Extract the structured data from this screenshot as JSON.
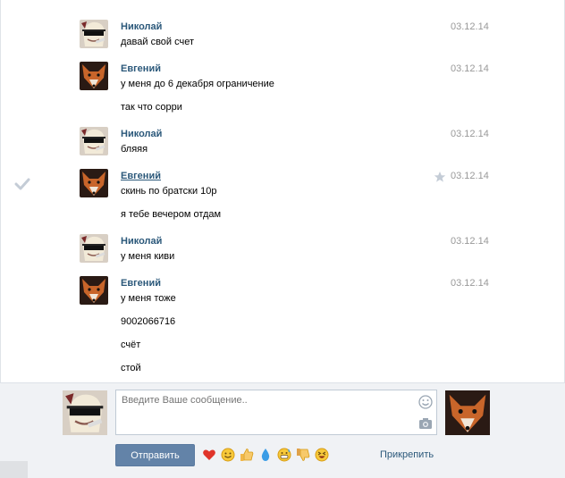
{
  "messages": [
    {
      "author": "Николай",
      "date": "03.12.14",
      "avatar": "nikolai",
      "lines": [
        "давай свой счет"
      ]
    },
    {
      "author": "Евгений",
      "date": "03.12.14",
      "avatar": "evgeny",
      "lines": [
        "у меня до 6 декабря ограничение",
        "так что сорри"
      ]
    },
    {
      "author": "Николай",
      "date": "03.12.14",
      "avatar": "nikolai",
      "lines": [
        "бляяя"
      ]
    },
    {
      "author": "Евгений",
      "date": "03.12.14",
      "avatar": "evgeny",
      "lines": [
        "скинь по братски 10р",
        "я тебе вечером отдам"
      ],
      "hovered": true
    },
    {
      "author": "Николай",
      "date": "03.12.14",
      "avatar": "nikolai",
      "lines": [
        "у меня киви"
      ]
    },
    {
      "author": "Евгений",
      "date": "03.12.14",
      "avatar": "evgeny",
      "lines": [
        "у меня тоже",
        "9002066716",
        "счёт",
        "стой"
      ]
    }
  ],
  "composer": {
    "placeholder": "Введите Ваше сообщение..",
    "send_label": "Отправить",
    "attach_label": "Прикрепить",
    "emojis": [
      "heart",
      "smile",
      "thumbs-up",
      "drop",
      "grin-sweat",
      "thumbs-down",
      "laugh"
    ]
  },
  "colors": {
    "link": "#2b587a",
    "date": "#999999",
    "button": "#6383a8",
    "composer_bg": "#f0f2f5"
  }
}
